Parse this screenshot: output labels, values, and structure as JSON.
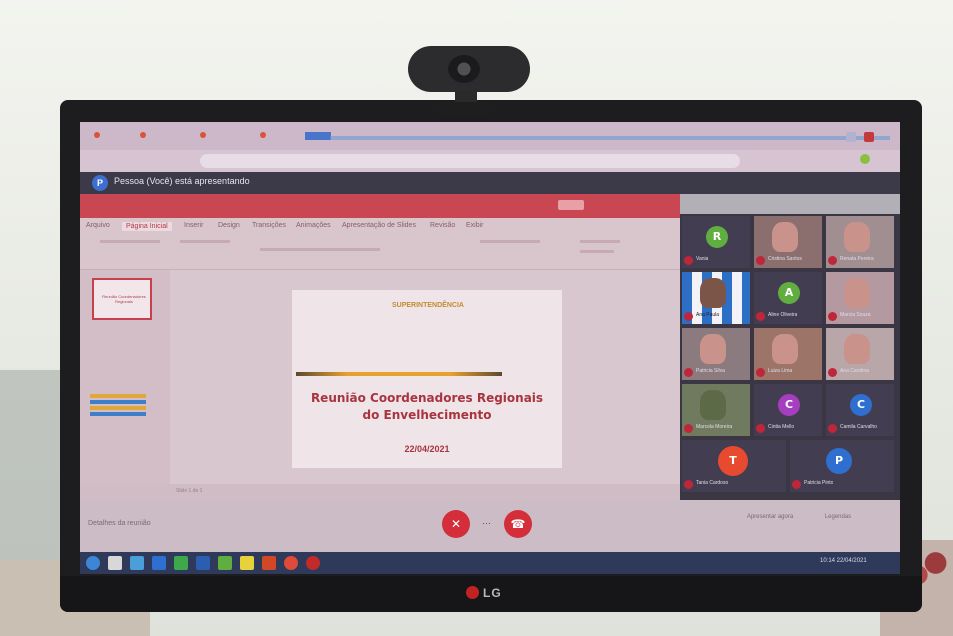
{
  "meet": {
    "presenter_text": "Pessoa (Você) está apresentando",
    "presenter_initial": "P",
    "meeting_code": "Detalhes da reunião"
  },
  "slide": {
    "logo_text": "SUPERINTENDÊNCIA",
    "title_line1": "Reunião Coordenadores Regionais",
    "title_line2": "do Envelhecimento",
    "date": "22/04/2021"
  },
  "ppt": {
    "tabs": [
      "Arquivo",
      "Página Inicial",
      "Inserir",
      "Design",
      "Transições",
      "Animações",
      "Apresentação de Slides",
      "Revisão",
      "Exibir"
    ],
    "status": "Slide 1 de 1"
  },
  "participants": [
    {
      "name": "Vania",
      "initial": "R",
      "color": "#5fae3f",
      "kind": "avatar"
    },
    {
      "name": "Cristina Santos",
      "kind": "photo"
    },
    {
      "name": "Renata Pereira",
      "kind": "photo"
    },
    {
      "name": "Ana Paula",
      "kind": "pattern"
    },
    {
      "name": "Aline Oliveira",
      "initial": "A",
      "color": "#5fae3f",
      "kind": "avatar"
    },
    {
      "name": "Marcia Souza",
      "kind": "photo"
    },
    {
      "name": "Patricia Silva",
      "kind": "photo"
    },
    {
      "name": "Luiza Lima",
      "kind": "photo"
    },
    {
      "name": "Ana Carolina",
      "kind": "photo"
    },
    {
      "name": "Marcela Moreira",
      "kind": "photo"
    },
    {
      "name": "Cintia Mello",
      "initial": "C",
      "color": "#a63fbf",
      "kind": "avatar"
    },
    {
      "name": "Camila Carvalho",
      "initial": "C",
      "color": "#2f6fd0",
      "kind": "avatar"
    },
    {
      "name": "Tania Cardoso",
      "initial": "T",
      "color": "#e84a2f",
      "kind": "avatar"
    },
    {
      "name": "Patricia Pinto",
      "initial": "P",
      "color": "#2f6fd0",
      "kind": "avatar"
    }
  ],
  "controls": {
    "mic_icon": "mic-off-icon",
    "hangup_icon": "hangup-icon",
    "more": "⋯",
    "right1": "Apresentar agora",
    "right2": "Legendas"
  },
  "monitor": {
    "brand": "LG"
  },
  "taskbar": {
    "clock": "10:14 22/04/2021"
  }
}
